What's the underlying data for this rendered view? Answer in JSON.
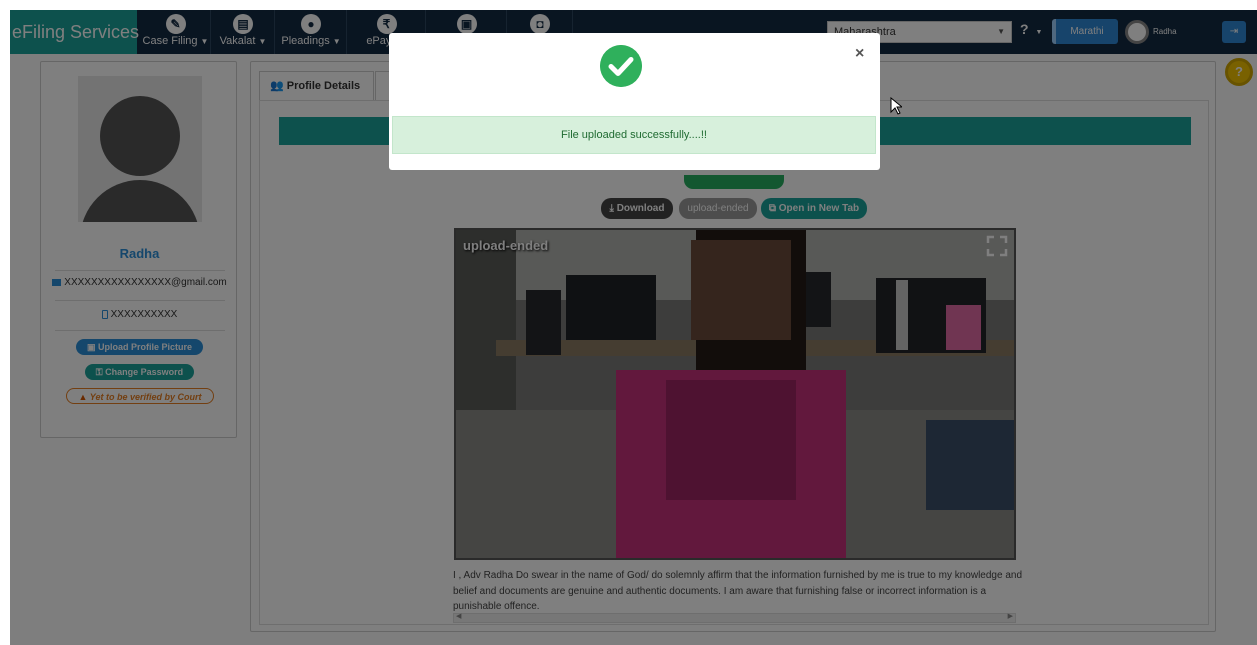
{
  "navbar": {
    "brand": "eFiling Services",
    "items": [
      {
        "label": "Case Filing",
        "icon": "pencil-icon"
      },
      {
        "label": "Vakalat",
        "icon": "document-icon"
      },
      {
        "label": "Pleadings",
        "icon": "stamp-icon"
      },
      {
        "label": "ePayme",
        "icon": "rupee-icon"
      },
      {
        "label": "",
        "icon": "file-icon"
      },
      {
        "label": "",
        "icon": "briefcase-icon"
      }
    ],
    "state_select": "Maharashtra",
    "help": "?",
    "language_button": "Marathi",
    "user_name": "Radha"
  },
  "profile": {
    "name": "Radha",
    "email": "XXXXXXXXXXXXXXXX@gmail.com",
    "phone": "XXXXXXXXXX",
    "upload_picture": "Upload Profile Picture",
    "change_password": "Change Password",
    "verification_status": "Yet to be verified by Court"
  },
  "main": {
    "tabs": [
      {
        "label": "Profile Details"
      }
    ],
    "buttons": {
      "download": "Download",
      "status": "upload-ended",
      "open_new_tab": "Open in New Tab"
    },
    "video_label": "upload-ended",
    "declaration": "I , Adv Radha Do swear in the name of God/ do solemnly affirm that the information furnished by me is true to my knowledge and belief and documents are genuine and authentic documents. I am aware that furnishing false or incorrect information is a punishable offence."
  },
  "modal": {
    "message": "File uploaded successfully....!!",
    "close": "×"
  },
  "colors": {
    "navbar_bg": "#132a43",
    "brand_teal": "#1aa39b",
    "success_green": "#2fb05c",
    "alert_bg": "#d7f0dc",
    "accent_blue": "#2a8fd8",
    "warning_orange": "#e67e22"
  }
}
